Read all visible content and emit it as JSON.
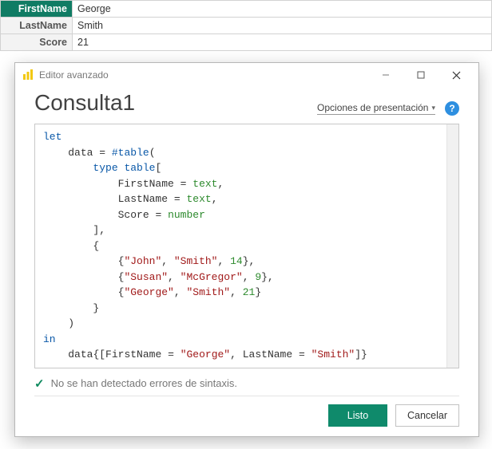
{
  "record": {
    "rows": [
      {
        "key": "FirstName",
        "val": "George"
      },
      {
        "key": "LastName",
        "val": "Smith"
      },
      {
        "key": "Score",
        "val": "21"
      }
    ]
  },
  "dialog": {
    "title": "Editor avanzado",
    "query_name": "Consulta1",
    "presentation_label": "Opciones de presentación",
    "status_text": "No se han detectado errores de sintaxis.",
    "buttons": {
      "done": "Listo",
      "cancel": "Cancelar"
    }
  },
  "code": {
    "let_kw": "let",
    "in_kw": "in",
    "data_ident": "data",
    "tablefn": "#table",
    "type_kw": "type",
    "table_kw": "table",
    "col_fn": "FirstName",
    "col_ln": "LastName",
    "col_sc": "Score",
    "text_type": "text",
    "number_type": "number",
    "rows": [
      {
        "a": "\"John\"",
        "b": "\"Smith\"",
        "c": "14"
      },
      {
        "a": "\"Susan\"",
        "b": "\"McGregor\"",
        "c": "9"
      },
      {
        "a": "\"George\"",
        "b": "\"Smith\"",
        "c": "21"
      }
    ],
    "lookup_fn": "\"George\"",
    "lookup_ln": "\"Smith\""
  }
}
